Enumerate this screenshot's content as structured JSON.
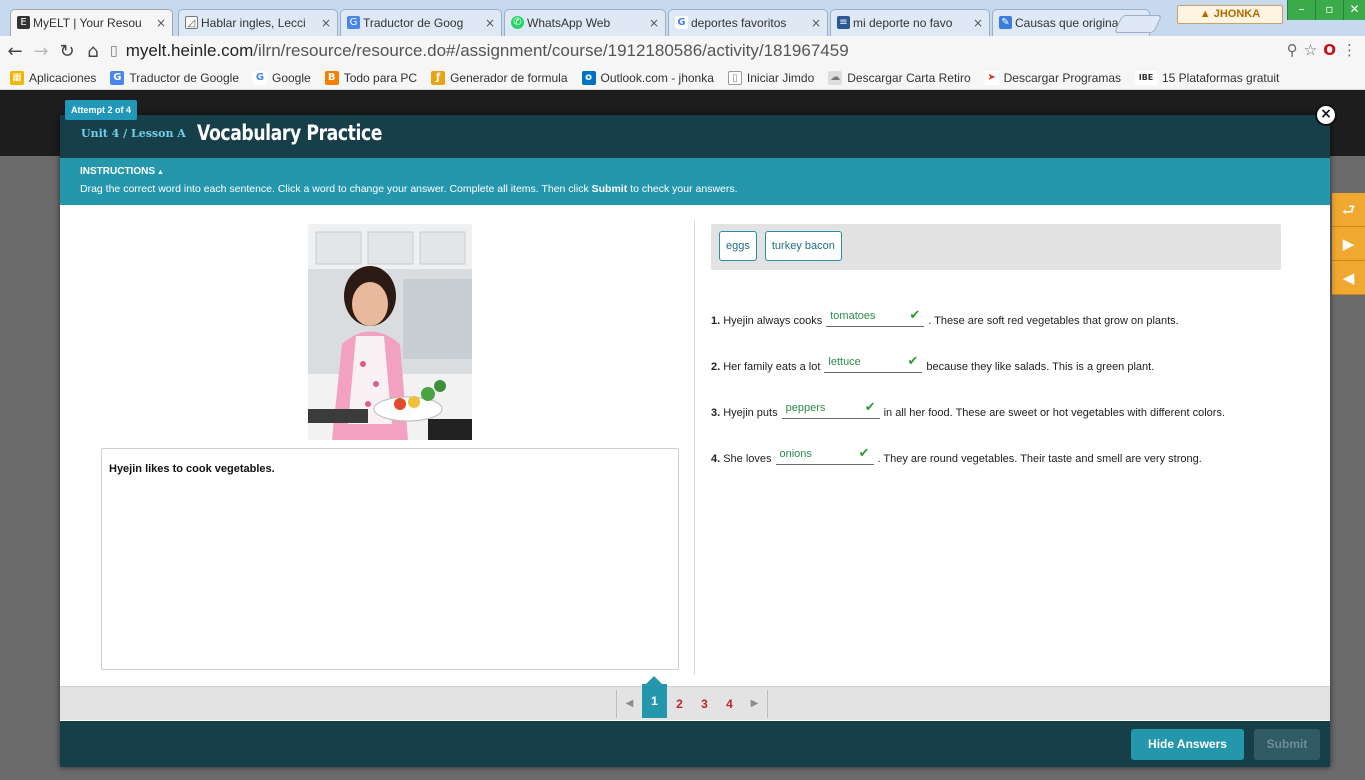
{
  "browser": {
    "tabs": [
      {
        "label": "MyELT | Your Resou",
        "icon": "myelt-icon",
        "icon_color": "#333333",
        "active": true
      },
      {
        "label": "Hablar ingles, Lecci",
        "icon": "triangle-icon",
        "icon_color": "#555555",
        "active": false
      },
      {
        "label": "Traductor de Goog",
        "icon": "google-translate-icon",
        "icon_color": "#4a86e8",
        "active": false
      },
      {
        "label": "WhatsApp Web",
        "icon": "whatsapp-icon",
        "icon_color": "#25d366",
        "active": false
      },
      {
        "label": "deportes favoritos",
        "icon": "google-icon",
        "icon_color": "#4285f4",
        "active": false
      },
      {
        "label": "mi deporte no favo",
        "icon": "doc-icon",
        "icon_color": "#2b5797",
        "active": false
      },
      {
        "label": "Causas que origina",
        "icon": "puzzle-icon",
        "icon_color": "#3b7ddd",
        "active": false
      }
    ],
    "profile_name": "JHONKA",
    "window_controls": [
      "–",
      "▫",
      "✕"
    ],
    "url_host": "myelt.heinle.com",
    "url_path": "/ilrn/resource/resource.do#/assignment/course/1912180586/activity/181967459",
    "bookmarks": [
      {
        "label": "Aplicaciones",
        "icon": "apps-grid-icon",
        "color": "#f4b400"
      },
      {
        "label": "Traductor de Google",
        "icon": "google-translate-icon",
        "color": "#4a86e8"
      },
      {
        "label": "Google",
        "icon": "google-icon",
        "color": "#4285f4"
      },
      {
        "label": "Todo para PC",
        "icon": "blogger-icon",
        "color": "#f57d00"
      },
      {
        "label": "Generador de formula",
        "icon": "formula-icon",
        "color": "#e8a317"
      },
      {
        "label": "Outlook.com - jhonka",
        "icon": "outlook-icon",
        "color": "#0072c6"
      },
      {
        "label": "Iniciar Jimdo",
        "icon": "page-icon",
        "color": "#888888"
      },
      {
        "label": "Descargar Carta Retiro",
        "icon": "cloud-icon",
        "color": "#999999"
      },
      {
        "label": "Descargar Programas",
        "icon": "arrow-logo-icon",
        "color": "#e53935"
      },
      {
        "label": "15 Plataformas gratuit",
        "icon": "ibe-icon",
        "color": "#333333"
      }
    ]
  },
  "modal": {
    "attempt": "Attempt 2 of 4",
    "unit_label": "Unit 4 / Lesson A",
    "title": "Vocabulary Practice",
    "instructions_heading": "INSTRUCTIONS",
    "instructions_text_before": "Drag the correct word into each sentence. Click a word to change your answer. Complete all items. Then click ",
    "instructions_text_bold": "Submit",
    "instructions_text_after": " to check your answers.",
    "caption": "Hyejin likes to cook vegetables.",
    "word_bank": [
      "eggs",
      "turkey bacon"
    ],
    "items": [
      {
        "num": "1.",
        "before": "Hyejin always cooks",
        "answer": "tomatoes",
        "after": ". These are soft red vegetables that grow on plants."
      },
      {
        "num": "2.",
        "before": "Her family eats a lot",
        "answer": "lettuce",
        "after": "because they like salads. This is a green plant."
      },
      {
        "num": "3.",
        "before": "Hyejin puts",
        "answer": "peppers",
        "after": "in all her food. These are sweet or hot vegetables with different colors."
      },
      {
        "num": "4.",
        "before": "She loves",
        "answer": "onions",
        "after": ". They are round vegetables. Their taste and smell are very strong."
      }
    ],
    "check_mark": "✔",
    "pages": [
      "1",
      "2",
      "3",
      "4"
    ],
    "current_page": "1",
    "hide_answers_label": "Hide Answers",
    "submit_label": "Submit"
  }
}
